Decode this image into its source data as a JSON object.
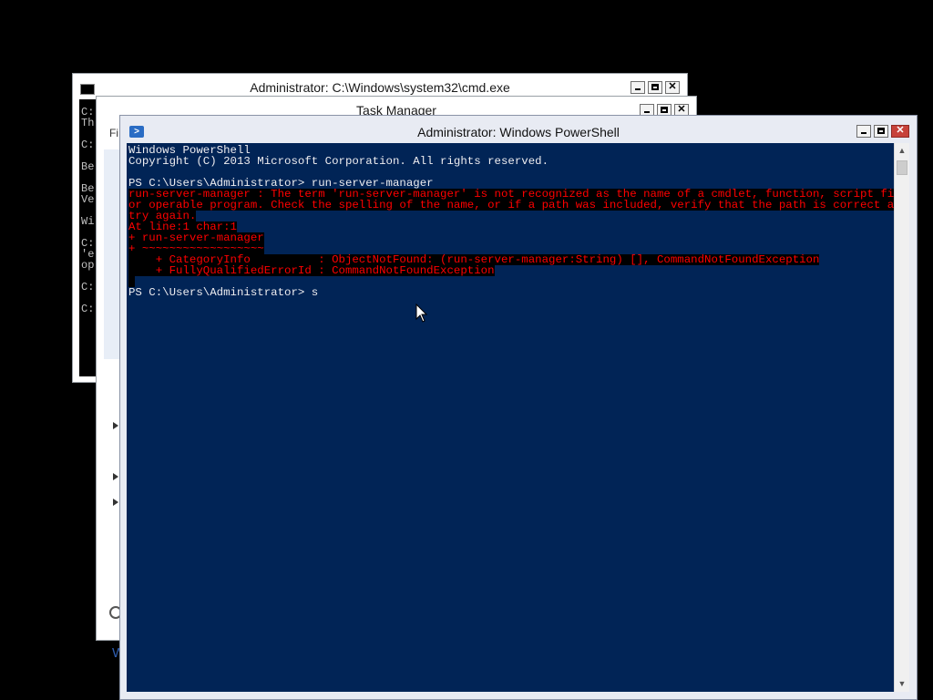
{
  "cmd": {
    "title": "Administrator: C:\\Windows\\system32\\cmd.exe",
    "lines": [
      "C:",
      "Th",
      "",
      "C:",
      "",
      "Be",
      "",
      "Be",
      "Ve",
      "",
      "Wi",
      "",
      "C:",
      "'e",
      "op",
      "",
      "C:",
      "",
      "C:"
    ]
  },
  "taskmanager": {
    "title": "Task Manager",
    "menu_file": "Fi",
    "footer_link": "W"
  },
  "powershell": {
    "title": "Administrator: Windows PowerShell",
    "header_line1": "Windows PowerShell",
    "header_line2": "Copyright (C) 2013 Microsoft Corporation. All rights reserved.",
    "prompt1": "PS C:\\Users\\Administrator> run-server-manager",
    "error_lines": [
      "run-server-manager : The term 'run-server-manager' is not recognized as the name of a cmdlet, function, script file,",
      "or operable program. Check the spelling of the name, or if a path was included, verify that the path is correct and",
      "try again.",
      "At line:1 char:1",
      "+ run-server-manager",
      "+ ~~~~~~~~~~~~~~~~~~",
      "    + CategoryInfo          : ObjectNotFound: (run-server-manager:String) [], CommandNotFoundException",
      "    + FullyQualifiedErrorId : CommandNotFoundException",
      " "
    ],
    "prompt2": "PS C:\\Users\\Administrator> s",
    "colors": {
      "console_bg": "#012456",
      "console_fg": "#eeedf0",
      "error_fg": "#ff0000",
      "error_bg": "#000000"
    }
  }
}
